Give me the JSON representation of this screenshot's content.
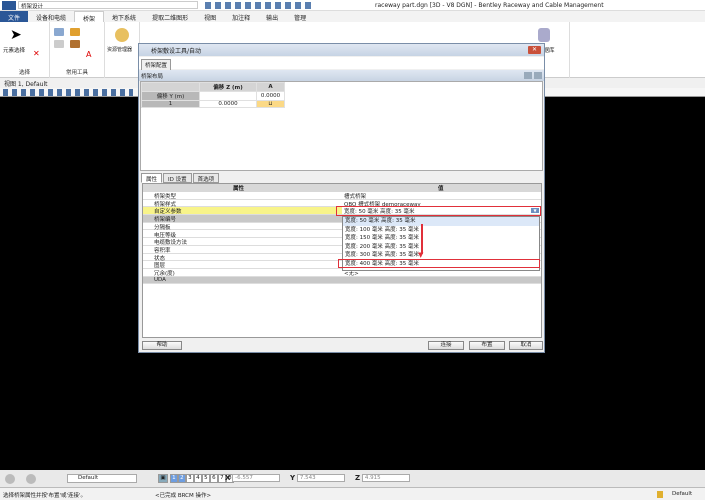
{
  "app": {
    "workflow": "桥架设计",
    "title": "raceway part.dgn [3D - V8 DGN] - Bentley Raceway and Cable Management"
  },
  "ribbon_tabs": [
    "文件",
    "设备和电缆",
    "桥架",
    "地下系统",
    "提取二维图形",
    "视图",
    "加注释",
    "输出",
    "管理"
  ],
  "ribbon": {
    "select_label": "元素选择",
    "group_select": "选择",
    "group_tools": "常用工具",
    "explorer": "资源管理器",
    "db": "数据库"
  },
  "view": {
    "title": "视图 1, Default"
  },
  "dialog": {
    "title": "桥架敷设工具/自动",
    "tab": "桥架配置",
    "layout_header": "桥架布局",
    "layout_grid": {
      "col_header": "偏移 Z (m)",
      "col_a": "A",
      "row_header": "偏移 Y (m)",
      "y_offset_a": "0.0000",
      "row1_label": "1",
      "row1_z": "0.0000"
    },
    "prop_tabs": [
      "属性",
      "ID 设置",
      "首选项"
    ],
    "prop_headers": {
      "property": "属性",
      "value": "值"
    },
    "properties": [
      {
        "k": "桥架类型",
        "v": "槽式桥架"
      },
      {
        "k": "桥架样式",
        "v": "OBO 槽式桥架 demoraceway"
      },
      {
        "k": "自定义参数",
        "v": "宽度: 50 毫米 高度: 35 毫米"
      },
      {
        "k": "桥架编号",
        "v": ""
      },
      {
        "k": "分隔板",
        "v": ""
      },
      {
        "k": "电压等级",
        "v": ""
      },
      {
        "k": "电缆敷设方法",
        "v": ""
      },
      {
        "k": "容积率",
        "v": ""
      },
      {
        "k": "状态",
        "v": ""
      },
      {
        "k": "图层",
        "v": ""
      },
      {
        "k": "冗余(度)",
        "v": "<无>"
      },
      {
        "k": "UDA",
        "v": ""
      }
    ],
    "dropdown_options": [
      "宽度: 50 毫米 高度: 35 毫米",
      "宽度: 100 毫米 高度: 35 毫米",
      "宽度: 150 毫米 高度: 35 毫米",
      "宽度: 200 毫米 高度: 35 毫米",
      "宽度: 300 毫米 高度: 35 毫米",
      "宽度: 400 毫米 高度: 35 毫米"
    ],
    "buttons": {
      "help": "帮助",
      "connect": "连接",
      "layout": "布置",
      "cancel": "取消"
    }
  },
  "bottom": {
    "view_group": "Default",
    "views": [
      "1",
      "2",
      "3",
      "4",
      "5",
      "6",
      "7",
      "8"
    ],
    "x_label": "X",
    "x": "-6.557",
    "y_label": "Y",
    "y": "7.543",
    "z_label": "Z",
    "z": "4.915"
  },
  "status": {
    "prompt": "选择桥架属性并按'布置'或'连接'。",
    "message": "<已完成 BRCM 操作>",
    "level": "Default"
  }
}
